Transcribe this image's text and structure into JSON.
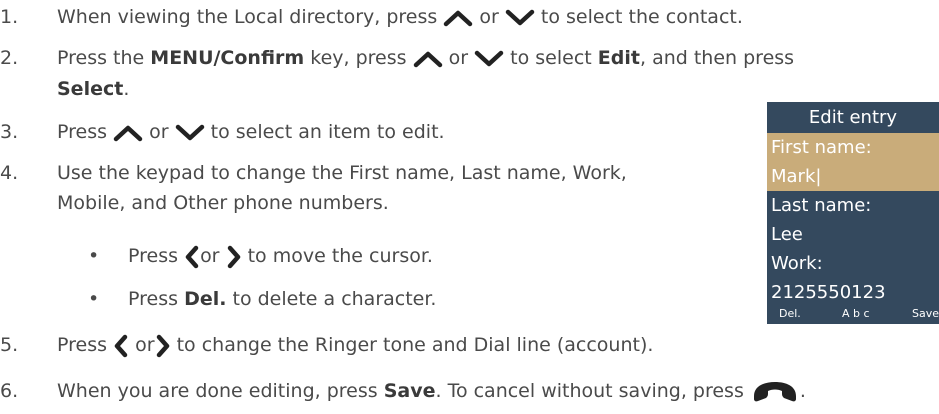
{
  "steps": [
    {
      "num": "1.",
      "parts": [
        "When viewing the Local directory, press",
        "or",
        "to select the contact."
      ]
    },
    {
      "num": "2.",
      "parts": [
        "Press the",
        "MENU/Confirm",
        "key, press",
        "or",
        "to select",
        "Edit",
        ", and then press",
        "Select",
        "."
      ]
    },
    {
      "num": "3.",
      "parts": [
        "Press",
        "or",
        "to select an item to edit."
      ]
    },
    {
      "num": "4.",
      "line1": "Use the keypad to change the First name, Last name, Work,",
      "line2": "Mobile, and Other phone numbers."
    },
    {
      "num": "5.",
      "parts": [
        "Press",
        "or",
        "to change the Ringer tone and Dial line (account)."
      ]
    },
    {
      "num": "6.",
      "parts": [
        "When you are done editing, press",
        "Save",
        ". To cancel without saving, press",
        "."
      ]
    }
  ],
  "bullets": [
    {
      "dot": "•",
      "parts": [
        "Press",
        "or",
        "to move the cursor."
      ]
    },
    {
      "dot": "•",
      "parts": [
        "Press",
        "Del.",
        "to delete a character."
      ]
    }
  ],
  "phone": {
    "title": "Edit entry",
    "rows": [
      {
        "text": "First name:",
        "selected": true
      },
      {
        "text": "Mark|",
        "selected": true
      },
      {
        "text": "Last name:",
        "selected": false
      },
      {
        "text": "Lee",
        "selected": false
      },
      {
        "text": "Work:",
        "selected": false
      },
      {
        "text": "2125550123",
        "selected": false
      }
    ],
    "softkeys": [
      "Del.",
      "A b c",
      "Save"
    ],
    "colors": {
      "screen_bg": "#34495e",
      "highlight": "#c9ac7a",
      "text": "#ffffff"
    }
  },
  "icons": [
    "up-arrow-icon",
    "down-arrow-icon",
    "left-arrow-icon",
    "right-arrow-icon",
    "end-call-icon"
  ]
}
